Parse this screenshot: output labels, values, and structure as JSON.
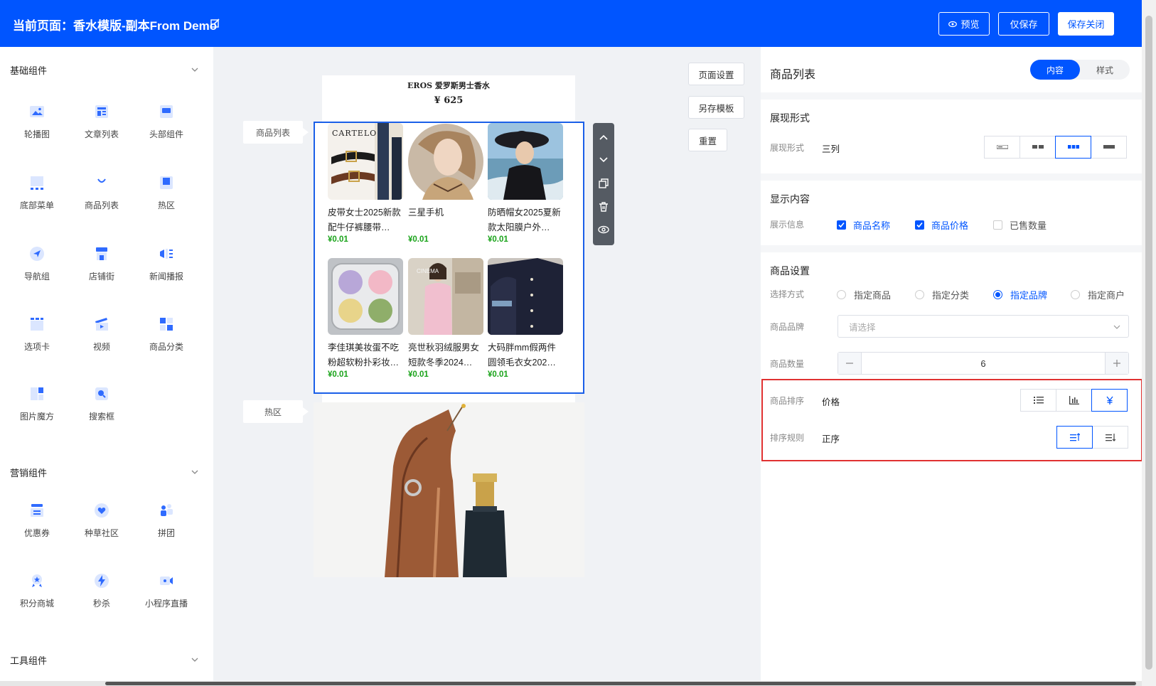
{
  "header": {
    "title": "当前页面：香水模版-副本From Demo",
    "preview_label": "预览",
    "save_only_label": "仅保存",
    "save_close_label": "保存关闭"
  },
  "left_panel": {
    "groups": [
      {
        "title": "基础组件",
        "items": [
          {
            "label": "轮播图",
            "icon": "carousel-icon"
          },
          {
            "label": "文章列表",
            "icon": "article-list-icon"
          },
          {
            "label": "头部组件",
            "icon": "header-component-icon"
          },
          {
            "label": "底部菜单",
            "icon": "bottom-menu-icon"
          },
          {
            "label": "商品列表",
            "icon": "product-list-icon"
          },
          {
            "label": "热区",
            "icon": "hotspot-icon"
          },
          {
            "label": "导航组",
            "icon": "navigation-icon"
          },
          {
            "label": "店铺街",
            "icon": "store-street-icon"
          },
          {
            "label": "新闻播报",
            "icon": "news-broadcast-icon"
          },
          {
            "label": "选项卡",
            "icon": "tabs-icon"
          },
          {
            "label": "视频",
            "icon": "video-icon"
          },
          {
            "label": "商品分类",
            "icon": "product-category-icon"
          },
          {
            "label": "图片魔方",
            "icon": "image-cube-icon"
          },
          {
            "label": "搜索框",
            "icon": "search-box-icon"
          }
        ]
      },
      {
        "title": "营销组件",
        "items": [
          {
            "label": "优惠券",
            "icon": "coupon-icon"
          },
          {
            "label": "种草社区",
            "icon": "community-icon"
          },
          {
            "label": "拼团",
            "icon": "group-buy-icon"
          },
          {
            "label": "积分商城",
            "icon": "points-mall-icon"
          },
          {
            "label": "秒杀",
            "icon": "flash-sale-icon"
          },
          {
            "label": "小程序直播",
            "icon": "live-stream-icon"
          }
        ]
      },
      {
        "title": "工具组件",
        "items": []
      }
    ]
  },
  "canvas": {
    "top_card": {
      "name": "EROS 爱罗斯男士香水",
      "price": "¥ 625"
    },
    "product_list_tag": "商品列表",
    "hotspot_tag": "热区",
    "products": [
      {
        "name": "皮带女士2025新款配牛仔裤腰带…",
        "price": "¥0.01"
      },
      {
        "name": "三星手机",
        "price": "¥0.01"
      },
      {
        "name": "防晒帽女2025夏新款太阳膜户外…",
        "price": "¥0.01"
      },
      {
        "name": "李佳琪美妆蛋不吃粉超软粉扑彩妆…",
        "price": "¥0.01"
      },
      {
        "name": "亮世秋羽绒服男女短款冬季2024…",
        "price": "¥0.01"
      },
      {
        "name": "大码胖mm假两件圆领毛衣女202…",
        "price": "¥0.01"
      }
    ],
    "image_text": {
      "belt_brand": "CARTELO",
      "cinema": "CINEMA"
    },
    "page_settings_label": "页面设置",
    "save_template_label": "另存模板",
    "reset_label": "重置"
  },
  "right_panel": {
    "title": "商品列表",
    "tab_content": "内容",
    "tab_style": "样式",
    "display": {
      "section_title": "展现形式",
      "label": "展现形式",
      "value": "三列"
    },
    "content": {
      "section_title": "显示内容",
      "label": "展示信息",
      "options": [
        {
          "label": "商品名称",
          "checked": true
        },
        {
          "label": "商品价格",
          "checked": true
        },
        {
          "label": "已售数量",
          "checked": false
        }
      ]
    },
    "settings": {
      "section_title": "商品设置",
      "method_label": "选择方式",
      "methods": [
        {
          "label": "指定商品",
          "selected": false
        },
        {
          "label": "指定分类",
          "selected": false
        },
        {
          "label": "指定品牌",
          "selected": true
        },
        {
          "label": "指定商户",
          "selected": false
        }
      ],
      "brand_label": "商品品牌",
      "brand_placeholder": "请选择",
      "count_label": "商品数量",
      "count_value": "6",
      "sort_label": "商品排序",
      "sort_value": "价格",
      "rule_label": "排序规则",
      "rule_value": "正序"
    }
  },
  "colors": {
    "primary": "#0055ff",
    "price_green": "#1aa31a",
    "highlight_red": "#e03131"
  }
}
